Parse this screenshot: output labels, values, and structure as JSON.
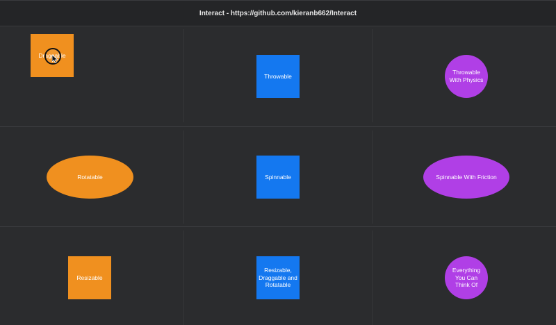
{
  "window": {
    "title": "Interact - https://github.com/kieranb662/Interact"
  },
  "items": [
    {
      "label": "Draggable"
    },
    {
      "label": "Throwable"
    },
    {
      "label": "Throwable With Physics"
    },
    {
      "label": "Rotatable"
    },
    {
      "label": "Spinnable"
    },
    {
      "label": "Spinnable With Friction"
    },
    {
      "label": "Resizable"
    },
    {
      "label": "Resizable, Draggable and Rotatable"
    },
    {
      "label": "Everything You Can Think Of"
    }
  ],
  "colors": {
    "orange": "#f0901f",
    "blue": "#1478f0",
    "purple": "#b03fe6",
    "background": "#2b2c2e"
  },
  "icons": {
    "cursor": "pointer-arrow-icon"
  }
}
